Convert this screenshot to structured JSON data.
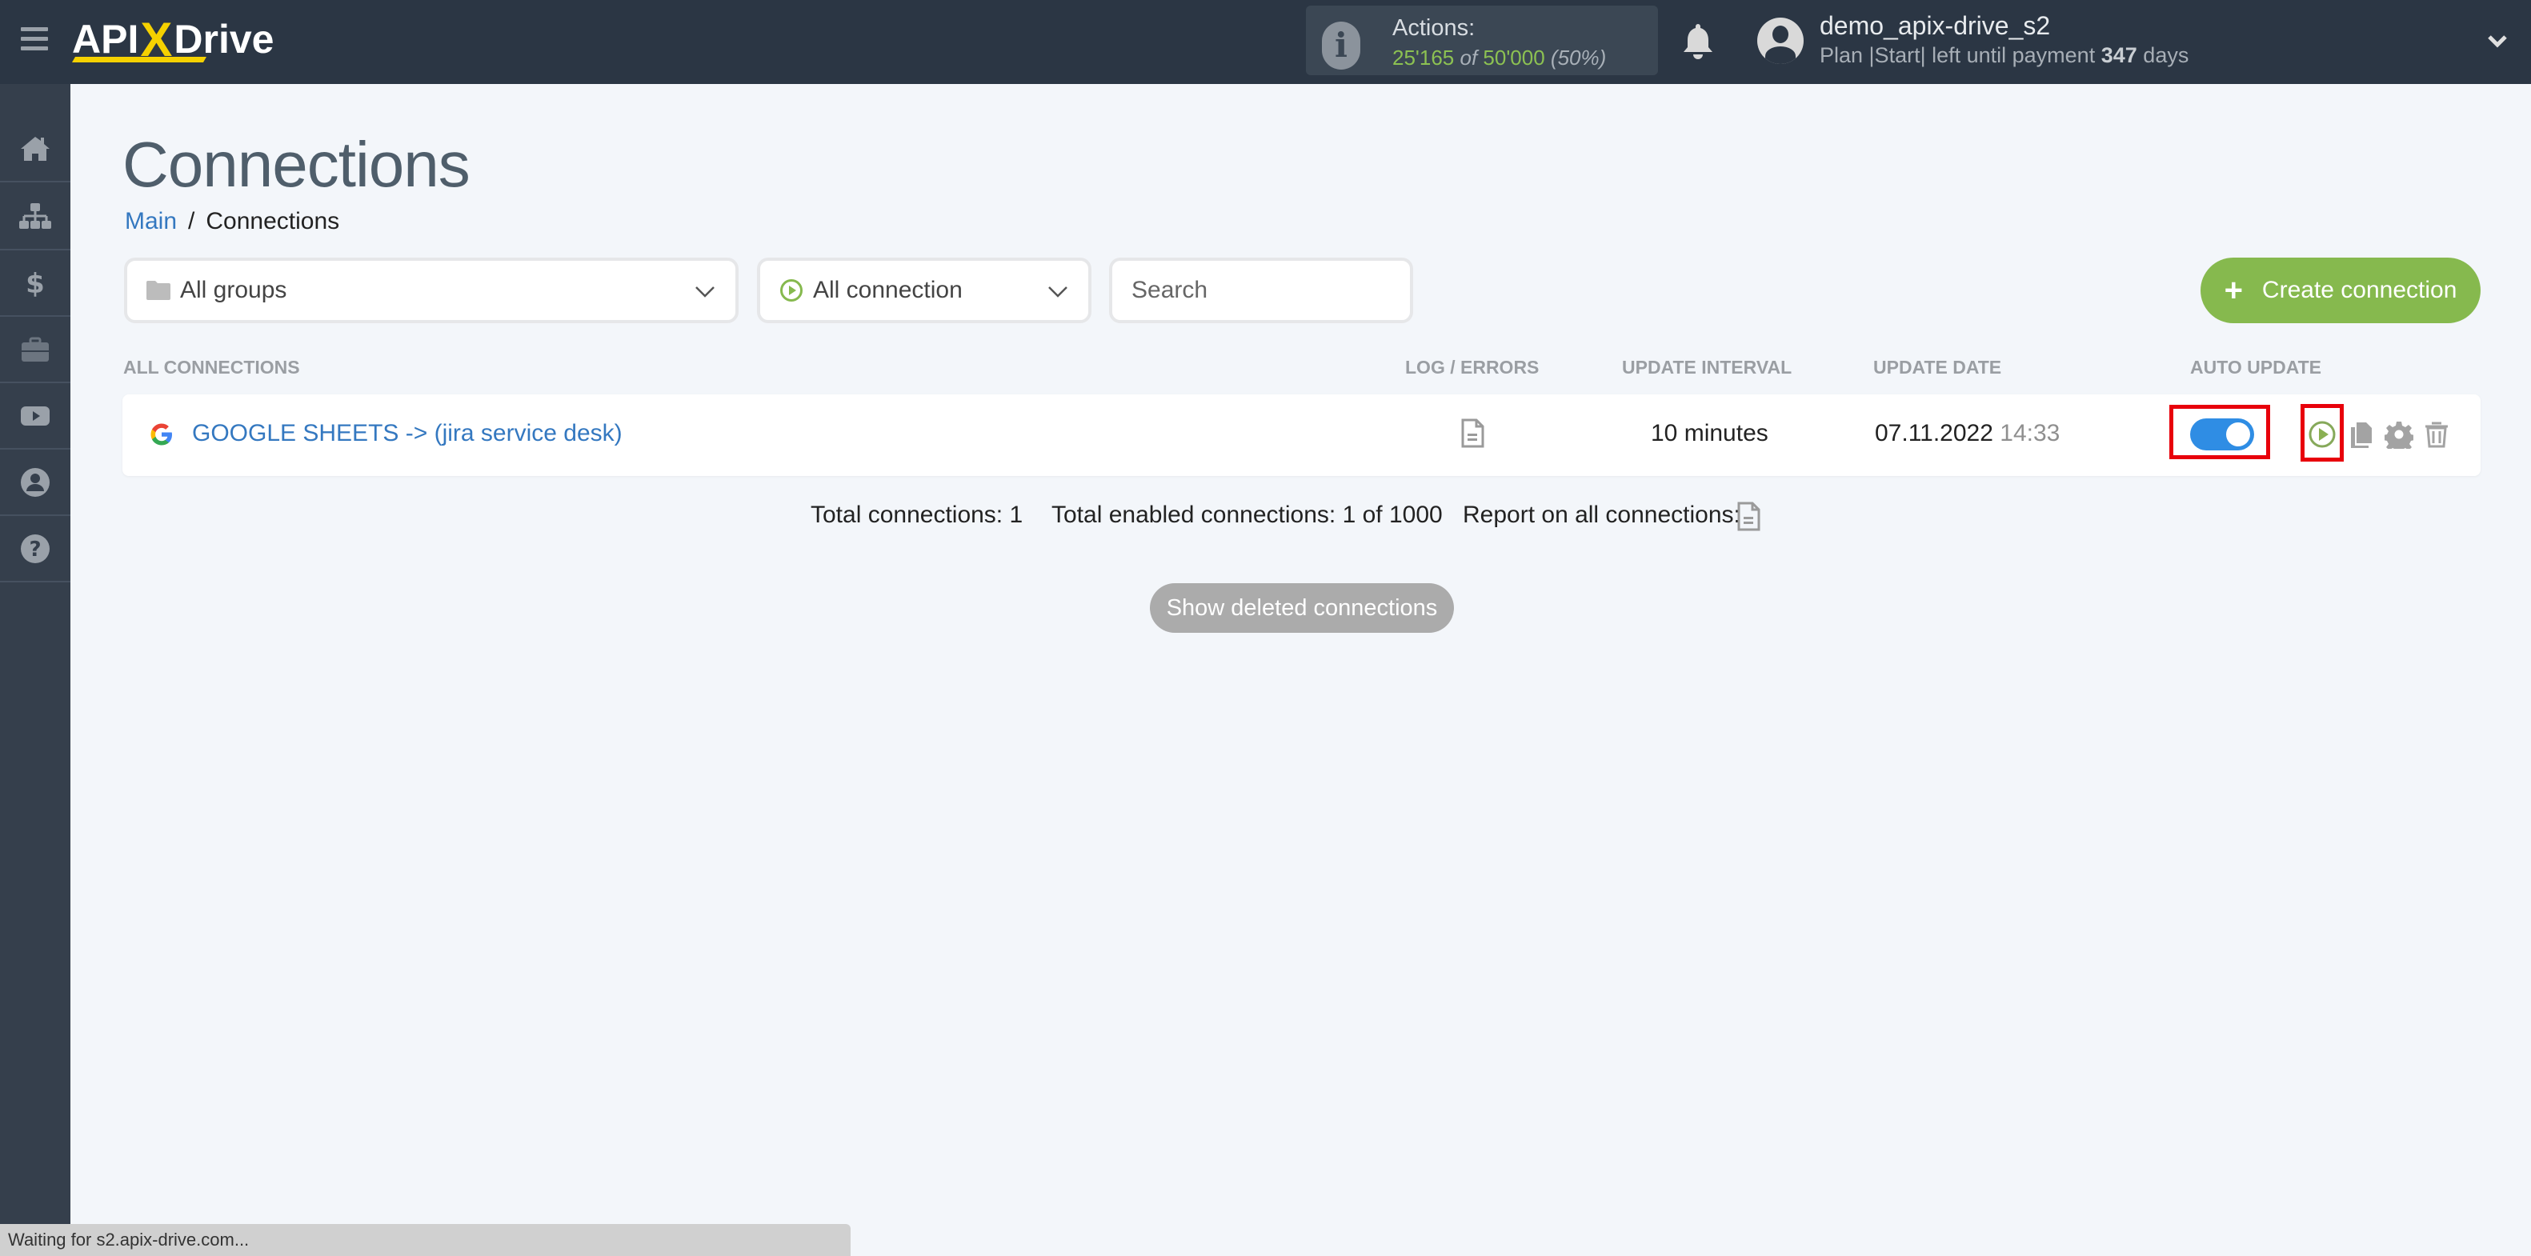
{
  "header": {
    "logo": {
      "part1": "API",
      "x": "X",
      "part2": "Drive"
    },
    "actions": {
      "label": "Actions:",
      "used": "25'165",
      "of": "of",
      "limit": "50'000",
      "percent": "(50%)"
    },
    "user": {
      "name": "demo_apix-drive_s2",
      "plan_prefix": "Plan |Start| left until payment",
      "days": "347",
      "days_suffix": "days"
    }
  },
  "sidebar": {
    "items": [
      {
        "name": "home",
        "icon": "home-icon"
      },
      {
        "name": "connections",
        "icon": "sitemap-icon"
      },
      {
        "name": "billing",
        "icon": "dollar-icon"
      },
      {
        "name": "services",
        "icon": "briefcase-icon"
      },
      {
        "name": "video",
        "icon": "youtube-icon"
      },
      {
        "name": "profile",
        "icon": "user-circle-icon"
      },
      {
        "name": "help",
        "icon": "question-circle-icon"
      }
    ]
  },
  "page": {
    "title": "Connections",
    "breadcrumb": {
      "main": "Main",
      "separator": "/",
      "current": "Connections"
    }
  },
  "filters": {
    "groups_selected": "All groups",
    "connection_selected": "All connection",
    "search_placeholder": "Search",
    "search_value": "",
    "create_label": "Create connection"
  },
  "table": {
    "headers": {
      "all": "ALL CONNECTIONS",
      "log": "LOG / ERRORS",
      "interval": "UPDATE INTERVAL",
      "date": "UPDATE DATE",
      "auto": "AUTO UPDATE"
    },
    "rows": [
      {
        "source_icon": "google-icon",
        "name": "GOOGLE SHEETS -> (jira service desk)",
        "interval": "10 minutes",
        "date": "07.11.2022",
        "time": "14:33",
        "auto_update": true
      }
    ]
  },
  "totals": {
    "total": "Total connections: 1",
    "enabled": "Total enabled connections: 1 of 1000",
    "report": "Report on all connections:"
  },
  "show_deleted_label": "Show deleted connections",
  "status_bar": "Waiting for s2.apix-drive.com...",
  "colors": {
    "header_bg": "#2b3644",
    "sidebar_bg": "#353f4c",
    "accent_green": "#86b94e",
    "link_blue": "#3478c0",
    "toggle_blue": "#2f8de4",
    "highlight_red": "#e8000b"
  }
}
